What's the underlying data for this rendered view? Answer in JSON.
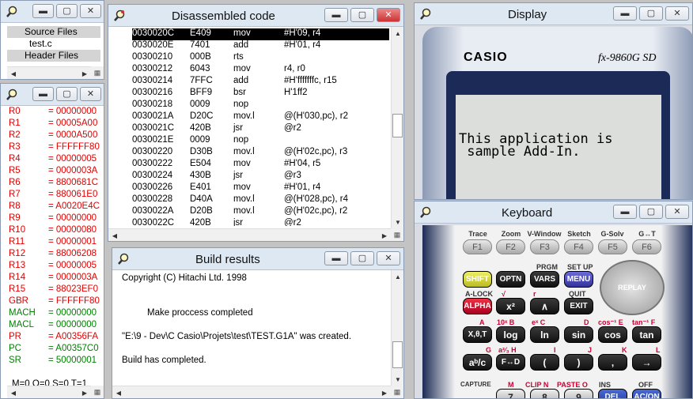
{
  "source_files": {
    "items": [
      "Source Files",
      "test.c",
      "Header Files"
    ]
  },
  "registers": {
    "items": [
      {
        "name": "R0",
        "value": "= 00000000"
      },
      {
        "name": "R1",
        "value": "= 00005A00"
      },
      {
        "name": "R2",
        "value": "= 0000A500"
      },
      {
        "name": "R3",
        "value": "= FFFFFF80"
      },
      {
        "name": "R4",
        "value": "= 00000005"
      },
      {
        "name": "R5",
        "value": "= 0000003A"
      },
      {
        "name": "R6",
        "value": "= 8800681C"
      },
      {
        "name": "R7",
        "value": "= 880061E0"
      },
      {
        "name": "R8",
        "value": "= A0020E4C"
      },
      {
        "name": "R9",
        "value": "= 00000000"
      },
      {
        "name": "R10",
        "value": "= 00000080"
      },
      {
        "name": "R11",
        "value": "= 00000001"
      },
      {
        "name": "R12",
        "value": "= 88006208"
      },
      {
        "name": "R13",
        "value": "= 00000005"
      },
      {
        "name": "R14",
        "value": "= 0000003A"
      },
      {
        "name": "R15",
        "value": "= 88023EF0"
      },
      {
        "name": "GBR",
        "value": "= FFFFFF80"
      },
      {
        "name": "MACH",
        "value": "= 00000000"
      },
      {
        "name": "MACL",
        "value": "= 00000000"
      },
      {
        "name": "PR",
        "value": "= A00356FA"
      },
      {
        "name": "PC",
        "value": "= A00357C0"
      },
      {
        "name": "SR",
        "value": "= 50000001"
      }
    ],
    "flags": "M=0 Q=0 S=0 T=1",
    "colors": {
      "red": "#e00000",
      "green": "#008000"
    }
  },
  "disasm": {
    "title": "Disassembled code",
    "rows": [
      {
        "addr": "0030020C",
        "code": "E409",
        "op": "mov",
        "args": "#H'09, r4",
        "selected": true
      },
      {
        "addr": "0030020E",
        "code": "7401",
        "op": "add",
        "args": "#H'01, r4"
      },
      {
        "addr": "00300210",
        "code": "000B",
        "op": "rts",
        "args": ""
      },
      {
        "addr": "00300212",
        "code": "6043",
        "op": "mov",
        "args": "r4, r0"
      },
      {
        "addr": "00300214",
        "code": "7FFC",
        "op": "add",
        "args": "#H'fffffffc, r15"
      },
      {
        "addr": "00300216",
        "code": "BFF9",
        "op": "bsr",
        "args": "H'1ff2"
      },
      {
        "addr": "00300218",
        "code": "0009",
        "op": "nop",
        "args": ""
      },
      {
        "addr": "0030021A",
        "code": "D20C",
        "op": "mov.l",
        "args": "@(H'030,pc), r2"
      },
      {
        "addr": "0030021C",
        "code": "420B",
        "op": "jsr",
        "args": "@r2"
      },
      {
        "addr": "0030021E",
        "code": "0009",
        "op": "nop",
        "args": ""
      },
      {
        "addr": "00300220",
        "code": "D30B",
        "op": "mov.l",
        "args": "@(H'02c,pc), r3"
      },
      {
        "addr": "00300222",
        "code": "E504",
        "op": "mov",
        "args": "#H'04, r5"
      },
      {
        "addr": "00300224",
        "code": "430B",
        "op": "jsr",
        "args": "@r3"
      },
      {
        "addr": "00300226",
        "code": "E401",
        "op": "mov",
        "args": "#H'01, r4"
      },
      {
        "addr": "00300228",
        "code": "D40A",
        "op": "mov.l",
        "args": "@(H'028,pc), r4"
      },
      {
        "addr": "0030022A",
        "code": "D20B",
        "op": "mov.l",
        "args": "@(H'02c,pc), r2"
      },
      {
        "addr": "0030022C",
        "code": "420B",
        "op": "jsr",
        "args": "@r2"
      }
    ]
  },
  "build": {
    "title": "Build results",
    "lines": [
      "Copyright (C) Hitachi Ltd. 1998",
      "Make proccess completed",
      "\"E:\\9 - Dev\\C Casio\\Projets\\test\\TEST.G1A\" was created.",
      "Build has completed."
    ]
  },
  "display": {
    "title": "Display",
    "brand": "CASIO",
    "model": "fx-9860G SD",
    "screen_lines": [
      "This application is",
      " sample Add-In."
    ]
  },
  "keyboard": {
    "title": "Keyboard",
    "fn_labels": [
      "Trace",
      "Zoom",
      "V-Window",
      "Sketch",
      "G-Solv",
      "G↔T"
    ],
    "fn_keys": [
      "F1",
      "F2",
      "F3",
      "F4",
      "F5",
      "F6"
    ],
    "row2_top": [
      "",
      "",
      "PRGM",
      "SET UP"
    ],
    "row2": [
      "SHIFT",
      "OPTN",
      "VARS",
      "MENU"
    ],
    "replay": "REPLAY",
    "row3_top": [
      "A-LOCK",
      "√",
      "r",
      "QUIT"
    ],
    "row3": [
      "ALPHA",
      "x²",
      "∧",
      "EXIT"
    ],
    "row4_top": [
      "A",
      "10ˣ B",
      "eˣ C",
      "D",
      "cos⁻¹ E",
      "tan⁻¹ F"
    ],
    "row4": [
      "X,θ,T",
      "log",
      "ln",
      "sin",
      "cos",
      "tan"
    ],
    "row5_top": [
      "G",
      "a²⁄₃ H",
      "I",
      "J",
      "K",
      "L"
    ],
    "row5": [
      "aᵇ/c",
      "F↔D",
      "(",
      ")",
      ",",
      "→"
    ],
    "row6_top": [
      "CAPTURE",
      "M",
      "CLIP N",
      "PASTE O",
      "INS",
      "OFF"
    ],
    "row6": [
      "7",
      "8",
      "9",
      "DEL",
      "AC/ON"
    ]
  }
}
